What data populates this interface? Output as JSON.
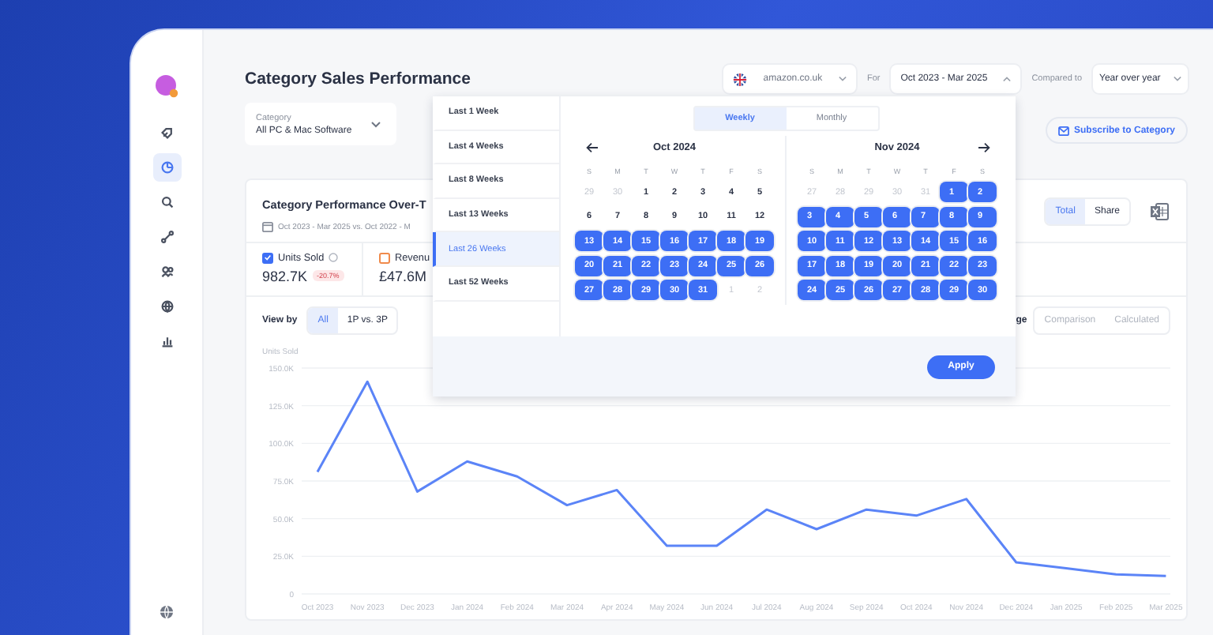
{
  "sidebar": {
    "items": [
      {
        "selected": false
      },
      {
        "selected": true
      },
      {
        "selected": false
      },
      {
        "selected": false
      },
      {
        "selected": false
      },
      {
        "selected": false
      },
      {
        "selected": false
      }
    ]
  },
  "header": {
    "title": "Category Sales Performance",
    "marketplace": "amazon.co.uk",
    "for_label": "For",
    "date_range": {
      "value": "Oct 2023 - Mar 2025",
      "open": true
    },
    "compared_label": "Compared to",
    "comparison": "Year over year"
  },
  "category": {
    "label": "Category",
    "value": "All PC & Mac Software"
  },
  "subscribe_button": "Subscribe to Category",
  "card": {
    "title": "Category Performance Over-T",
    "dates": "Oct 2023 - Mar 2025 vs. Oct 2022 - M",
    "display_modes": [
      {
        "label": "Total",
        "selected": true
      },
      {
        "label": "Share",
        "selected": false
      }
    ],
    "metrics": [
      {
        "label": "Units Sold",
        "checked": true,
        "color": "#3d6ef5",
        "value": "982.7K",
        "change": "-20.7%"
      },
      {
        "label": "Revenu",
        "checked": false,
        "color": "#f08a4b",
        "value": "£47.6M"
      }
    ],
    "view_by_label": "View by",
    "view_by": [
      {
        "label": "All",
        "selected": true
      },
      {
        "label": "1P vs. 3P",
        "selected": false
      }
    ],
    "cut_label": "ge",
    "value_modes": [
      {
        "label": "Comparison",
        "disabled": true
      },
      {
        "label": "Calculated",
        "disabled": true
      }
    ],
    "chart_data": {
      "type": "line",
      "ylabel": "Units Sold",
      "categories": [
        "Oct 2023",
        "Nov 2023",
        "Dec 2023",
        "Jan 2024",
        "Feb 2024",
        "Mar 2024",
        "Apr 2024",
        "May 2024",
        "Jun 2024",
        "Jul 2024",
        "Aug 2024",
        "Sep 2024",
        "Oct 2024",
        "Nov 2024",
        "Dec 2024",
        "Jan 2025",
        "Feb 2025",
        "Mar 2025"
      ],
      "grid": true,
      "series": [
        {
          "color": "#5b84f7",
          "values": [
            81000,
            141000,
            68000,
            88000,
            78000,
            59000,
            69000,
            32000,
            32000,
            56000,
            43000,
            56000,
            52000,
            63000,
            21000,
            17000,
            13000,
            12000
          ]
        }
      ],
      "ylim": [
        0,
        150000
      ],
      "yticks": [
        {
          "value": 0,
          "label": "0"
        },
        {
          "value": 25000,
          "label": "25.0K"
        },
        {
          "value": 50000,
          "label": "50.0K"
        },
        {
          "value": 75000,
          "label": "75.0K"
        },
        {
          "value": 100000,
          "label": "100.0K"
        },
        {
          "value": 125000,
          "label": "125.0K"
        },
        {
          "value": 150000,
          "label": "150.0K"
        }
      ]
    }
  },
  "picker": {
    "ranges": [
      {
        "label": "Last 1 Week",
        "selected": false
      },
      {
        "label": "Last 4 Weeks",
        "selected": false
      },
      {
        "label": "Last 8 Weeks",
        "selected": false
      },
      {
        "label": "Last 13 Weeks",
        "selected": false
      },
      {
        "label": "Last 26 Weeks",
        "selected": true
      },
      {
        "label": "Last 52 Weeks",
        "selected": false
      }
    ],
    "tabs": [
      {
        "label": "Weekly",
        "selected": true
      },
      {
        "label": "Monthly",
        "selected": false
      }
    ],
    "months": [
      {
        "title": "Oct 2024",
        "weekdays": [
          "S",
          "M",
          "T",
          "W",
          "T",
          "F",
          "S"
        ],
        "weeks": [
          [
            {
              "d": "29",
              "muted": true,
              "selected": false
            },
            {
              "d": "30",
              "muted": true,
              "selected": false
            },
            {
              "d": "1",
              "muted": false,
              "selected": false
            },
            {
              "d": "2",
              "muted": false,
              "selected": false
            },
            {
              "d": "3",
              "muted": false,
              "selected": false
            },
            {
              "d": "4",
              "muted": false,
              "selected": false
            },
            {
              "d": "5",
              "muted": false,
              "selected": false
            }
          ],
          [
            {
              "d": "6",
              "muted": false,
              "selected": false
            },
            {
              "d": "7",
              "muted": false,
              "selected": false
            },
            {
              "d": "8",
              "muted": false,
              "selected": false
            },
            {
              "d": "9",
              "muted": false,
              "selected": false
            },
            {
              "d": "10",
              "muted": false,
              "selected": false
            },
            {
              "d": "11",
              "muted": false,
              "selected": false
            },
            {
              "d": "12",
              "muted": false,
              "selected": false
            }
          ],
          [
            {
              "d": "13",
              "muted": false,
              "selected": true
            },
            {
              "d": "14",
              "muted": false,
              "selected": true
            },
            {
              "d": "15",
              "muted": false,
              "selected": true
            },
            {
              "d": "16",
              "muted": false,
              "selected": true
            },
            {
              "d": "17",
              "muted": false,
              "selected": true
            },
            {
              "d": "18",
              "muted": false,
              "selected": true
            },
            {
              "d": "19",
              "muted": false,
              "selected": true
            }
          ],
          [
            {
              "d": "20",
              "muted": false,
              "selected": true
            },
            {
              "d": "21",
              "muted": false,
              "selected": true
            },
            {
              "d": "22",
              "muted": false,
              "selected": true
            },
            {
              "d": "23",
              "muted": false,
              "selected": true
            },
            {
              "d": "24",
              "muted": false,
              "selected": true
            },
            {
              "d": "25",
              "muted": false,
              "selected": true
            },
            {
              "d": "26",
              "muted": false,
              "selected": true
            }
          ],
          [
            {
              "d": "27",
              "muted": false,
              "selected": true
            },
            {
              "d": "28",
              "muted": false,
              "selected": true
            },
            {
              "d": "29",
              "muted": false,
              "selected": true
            },
            {
              "d": "30",
              "muted": false,
              "selected": true
            },
            {
              "d": "31",
              "muted": false,
              "selected": true
            },
            {
              "d": "1",
              "muted": true,
              "selected": false
            },
            {
              "d": "2",
              "muted": true,
              "selected": false
            }
          ]
        ]
      },
      {
        "title": "Nov 2024",
        "weekdays": [
          "S",
          "M",
          "T",
          "W",
          "T",
          "F",
          "S"
        ],
        "weeks": [
          [
            {
              "d": "27",
              "muted": true,
              "selected": false
            },
            {
              "d": "28",
              "muted": true,
              "selected": false
            },
            {
              "d": "29",
              "muted": true,
              "selected": false
            },
            {
              "d": "30",
              "muted": true,
              "selected": false
            },
            {
              "d": "31",
              "muted": true,
              "selected": false
            },
            {
              "d": "1",
              "muted": false,
              "selected": true
            },
            {
              "d": "2",
              "muted": false,
              "selected": true
            }
          ],
          [
            {
              "d": "3",
              "muted": false,
              "selected": true
            },
            {
              "d": "4",
              "muted": false,
              "selected": true
            },
            {
              "d": "5",
              "muted": false,
              "selected": true
            },
            {
              "d": "6",
              "muted": false,
              "selected": true
            },
            {
              "d": "7",
              "muted": false,
              "selected": true
            },
            {
              "d": "8",
              "muted": false,
              "selected": true
            },
            {
              "d": "9",
              "muted": false,
              "selected": true
            }
          ],
          [
            {
              "d": "10",
              "muted": false,
              "selected": true
            },
            {
              "d": "11",
              "muted": false,
              "selected": true
            },
            {
              "d": "12",
              "muted": false,
              "selected": true
            },
            {
              "d": "13",
              "muted": false,
              "selected": true
            },
            {
              "d": "14",
              "muted": false,
              "selected": true
            },
            {
              "d": "15",
              "muted": false,
              "selected": true
            },
            {
              "d": "16",
              "muted": false,
              "selected": true
            }
          ],
          [
            {
              "d": "17",
              "muted": false,
              "selected": true
            },
            {
              "d": "18",
              "muted": false,
              "selected": true
            },
            {
              "d": "19",
              "muted": false,
              "selected": true
            },
            {
              "d": "20",
              "muted": false,
              "selected": true
            },
            {
              "d": "21",
              "muted": false,
              "selected": true
            },
            {
              "d": "22",
              "muted": false,
              "selected": true
            },
            {
              "d": "23",
              "muted": false,
              "selected": true
            }
          ],
          [
            {
              "d": "24",
              "muted": false,
              "selected": true
            },
            {
              "d": "25",
              "muted": false,
              "selected": true
            },
            {
              "d": "26",
              "muted": false,
              "selected": true
            },
            {
              "d": "27",
              "muted": false,
              "selected": true
            },
            {
              "d": "28",
              "muted": false,
              "selected": true
            },
            {
              "d": "29",
              "muted": false,
              "selected": true
            },
            {
              "d": "30",
              "muted": false,
              "selected": true
            }
          ]
        ]
      }
    ],
    "apply": "Apply"
  }
}
